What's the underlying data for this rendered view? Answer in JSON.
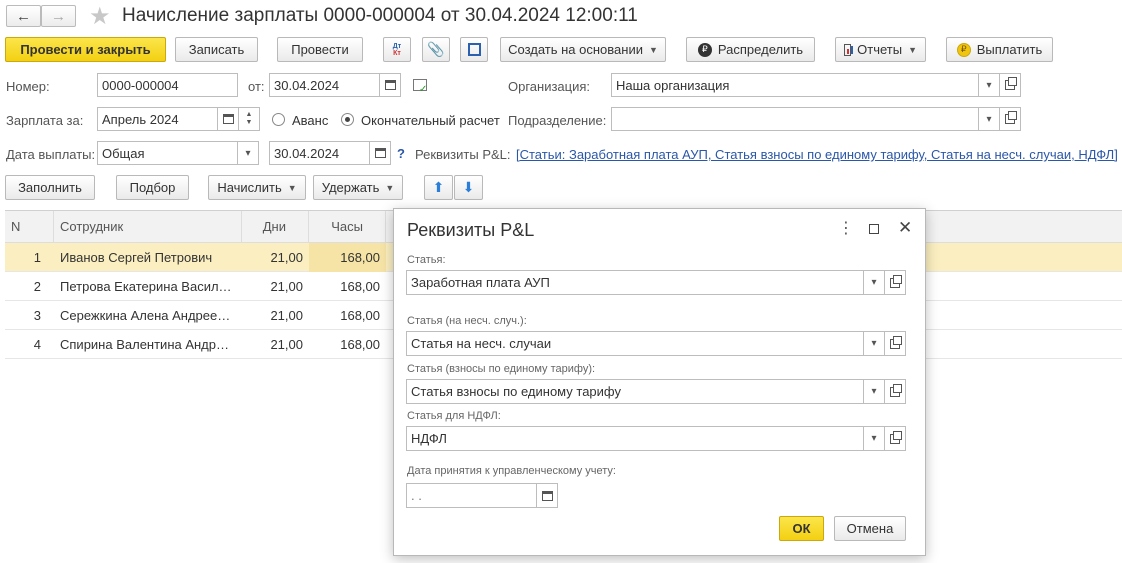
{
  "window": {
    "title": "Начисление зарплаты 0000-000004 от 30.04.2024 12:00:11"
  },
  "toolbar": {
    "post_close": "Провести и закрыть",
    "save": "Записать",
    "post": "Провести",
    "dt_kt": "Дт Кт",
    "create_basis": "Создать на основании",
    "distribute": "Распределить",
    "reports": "Отчеты",
    "pay": "Выплатить"
  },
  "form": {
    "number_label": "Номер:",
    "number": "0000-000004",
    "from_label": "от:",
    "date": "30.04.2024",
    "org_label": "Организация:",
    "org": "Наша организация",
    "salary_for_label": "Зарплата за:",
    "salary_for": "Апрель 2024",
    "advance_label": "Аванс",
    "final_label": "Окончательный расчет",
    "final_selected": true,
    "dept_label": "Подразделение:",
    "dept": "",
    "pay_date_label": "Дата выплаты:",
    "pay_date_type": "Общая",
    "pay_date": "30.04.2024",
    "help": "?",
    "pl_label": "Реквизиты P&L:",
    "pl_link": "[Статьи: Заработная плата АУП, Статья взносы по единому тарифу, Статья на несч. случаи, НДФЛ]"
  },
  "table_toolbar": {
    "fill": "Заполнить",
    "pick": "Подбор",
    "accrue": "Начислить",
    "withhold": "Удержать"
  },
  "table": {
    "columns": [
      "N",
      "Сотрудник",
      "Дни",
      "Часы"
    ],
    "rows": [
      {
        "n": "1",
        "name": "Иванов Сергей Петрович",
        "days": "21,00",
        "hours": "168,00"
      },
      {
        "n": "2",
        "name": "Петрова Екатерина Васил…",
        "days": "21,00",
        "hours": "168,00"
      },
      {
        "n": "3",
        "name": "Сережкина Алена Андрее…",
        "days": "21,00",
        "hours": "168,00"
      },
      {
        "n": "4",
        "name": "Спирина Валентина Андр…",
        "days": "21,00",
        "hours": "168,00"
      }
    ]
  },
  "dialog": {
    "title": "Реквизиты P&L",
    "f1_label": "Статья:",
    "f1": "Заработная плата АУП",
    "f2_label": "Статья (на несч. случ.):",
    "f2": "Статья на несч. случаи",
    "f3_label": "Статья (взносы по единому тарифу):",
    "f3": "Статья взносы по единому тарифу",
    "f4_label": "Статья для НДФЛ:",
    "f4": "НДФЛ",
    "f5_label": "Дата принятия к управленческому учету:",
    "f5": " .  .",
    "ok": "ОК",
    "cancel": "Отмена"
  }
}
